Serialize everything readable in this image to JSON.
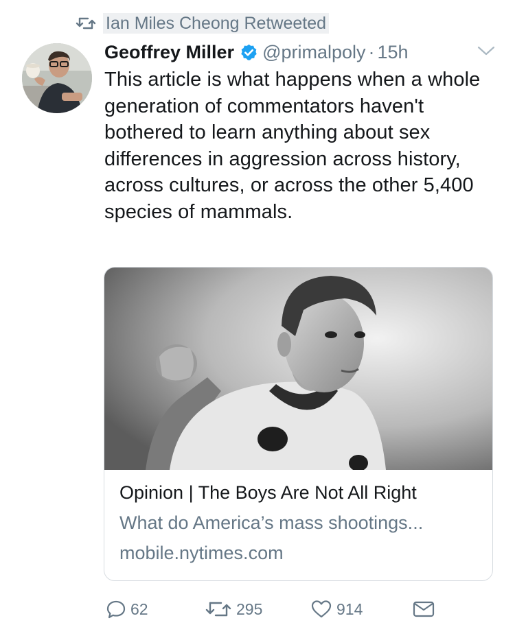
{
  "retweet_context": {
    "label": "Ian Miles Cheong Retweeted",
    "icon": "retweet-icon"
  },
  "tweet": {
    "author_name": "Geoffrey Miller",
    "verified_icon": "verified-badge-icon",
    "handle": "@primalpoly",
    "separator": "·",
    "time": "15h",
    "menu_icon": "chevron-down-icon",
    "text": "This article is what happens when a whole generation of commentators haven't bothered to learn anything about sex differences in aggression across history, across cultures, or across the other 5,400 species of mammals."
  },
  "link_card": {
    "image": "photo of boy flexing arm",
    "title": "Opinion | The Boys Are Not All Right",
    "description": "What do America’s mass shootings...",
    "domain": "mobile.nytimes.com"
  },
  "actions": {
    "reply_count": "62",
    "retweet_count": "295",
    "like_count": "914",
    "reply_icon": "reply-icon",
    "retweet_icon": "retweet-icon",
    "like_icon": "heart-icon",
    "dm_icon": "envelope-icon"
  },
  "colors": {
    "text": "#14171a",
    "secondary": "#657786",
    "verified": "#1da1f2",
    "border": "#d6dbe0"
  }
}
